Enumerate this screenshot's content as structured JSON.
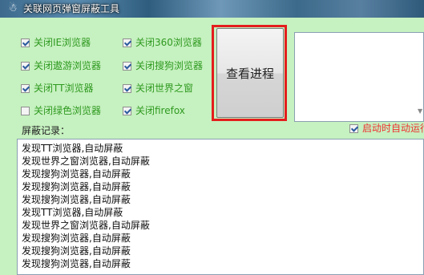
{
  "window": {
    "title": "关联网页弹窗屏蔽工具",
    "icon": "app-figure-icon"
  },
  "options": [
    {
      "label": "关闭IE浏览器",
      "checked": true
    },
    {
      "label": "关闭360浏览器",
      "checked": true
    },
    {
      "label": "关闭遨游浏览器",
      "checked": true
    },
    {
      "label": "关闭搜狗浏览器",
      "checked": true
    },
    {
      "label": "关闭TT浏览器",
      "checked": true
    },
    {
      "label": "关闭世界之窗",
      "checked": true
    },
    {
      "label": "关闭绿色浏览器",
      "checked": false
    },
    {
      "label": "关闭firefox",
      "checked": true
    }
  ],
  "view_process_button": "查看进程",
  "log_label": "屏蔽记录：",
  "autostart": {
    "label": "启动时自动运行",
    "checked": true
  },
  "log_lines": [
    "发现TT浏览器,自动屏蔽",
    "发现世界之窗浏览器,自动屏蔽",
    "发现搜狗浏览器,自动屏蔽",
    "发现搜狗浏览器,自动屏蔽",
    "发现搜狗浏览器,自动屏蔽",
    "发现TT浏览器,自动屏蔽",
    "发现世界之窗浏览器,自动屏蔽",
    "发现搜狗浏览器,自动屏蔽",
    "发现搜狗浏览器,自动屏蔽",
    "发现搜狗浏览器,自动屏蔽"
  ],
  "colors": {
    "checkbox_label": "#2f9a20",
    "highlight_border": "#e41d1d",
    "autostart_label": "#e33333"
  }
}
